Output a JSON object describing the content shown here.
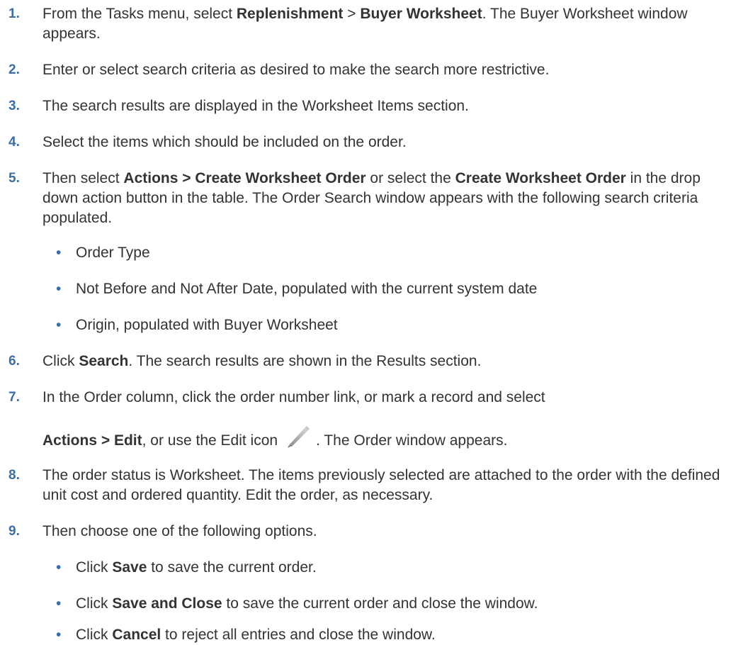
{
  "steps": [
    {
      "num": "1.",
      "parts": [
        "From the Tasks menu, select ",
        "Replenishment",
        " > ",
        "Buyer Worksheet",
        ". The Buyer Worksheet window appears."
      ]
    },
    {
      "num": "2.",
      "text": "Enter or select search criteria as desired to make the search more restrictive."
    },
    {
      "num": "3.",
      "text": "The search results are displayed in the Worksheet Items section."
    },
    {
      "num": "4.",
      "text": "Select the items which should be included on the order."
    },
    {
      "num": "5.",
      "parts": [
        "Then select ",
        "Actions > Create Worksheet Order",
        " or select the ",
        "Create Worksheet Order",
        " in the drop down action button in the table. The Order Search window appears with the following search criteria populated."
      ],
      "bullets": [
        "Order Type",
        "Not Before and Not After Date, populated with the current system date",
        "Origin, populated with Buyer Worksheet"
      ]
    },
    {
      "num": "6.",
      "parts": [
        "Click ",
        "Search",
        ". The search results are shown in the Results section."
      ]
    },
    {
      "num": "7.",
      "line1": "In the Order column, click the order number link, or mark a record and select",
      "parts": [
        "Actions > Edit",
        ", or use the Edit icon",
        ". The Order window appears."
      ]
    },
    {
      "num": "8.",
      "text": "The order status is Worksheet. The items previously selected are attached to the order with the defined unit cost and ordered quantity. Edit the order, as necessary."
    },
    {
      "num": "9.",
      "text": "Then choose one of the following options.",
      "bullets": [
        {
          "parts": [
            "Click ",
            "Save",
            " to save the current order."
          ]
        },
        {
          "parts": [
            "Click ",
            "Save and Close",
            " to save the current order and close the window."
          ]
        },
        {
          "parts": [
            "Click ",
            "Cancel",
            " to reject all entries and close the window."
          ]
        }
      ]
    }
  ],
  "bullet_char": "•",
  "icon": "pencil-edit-icon",
  "colors": {
    "number": "#3a6ea5",
    "text": "#333333"
  }
}
